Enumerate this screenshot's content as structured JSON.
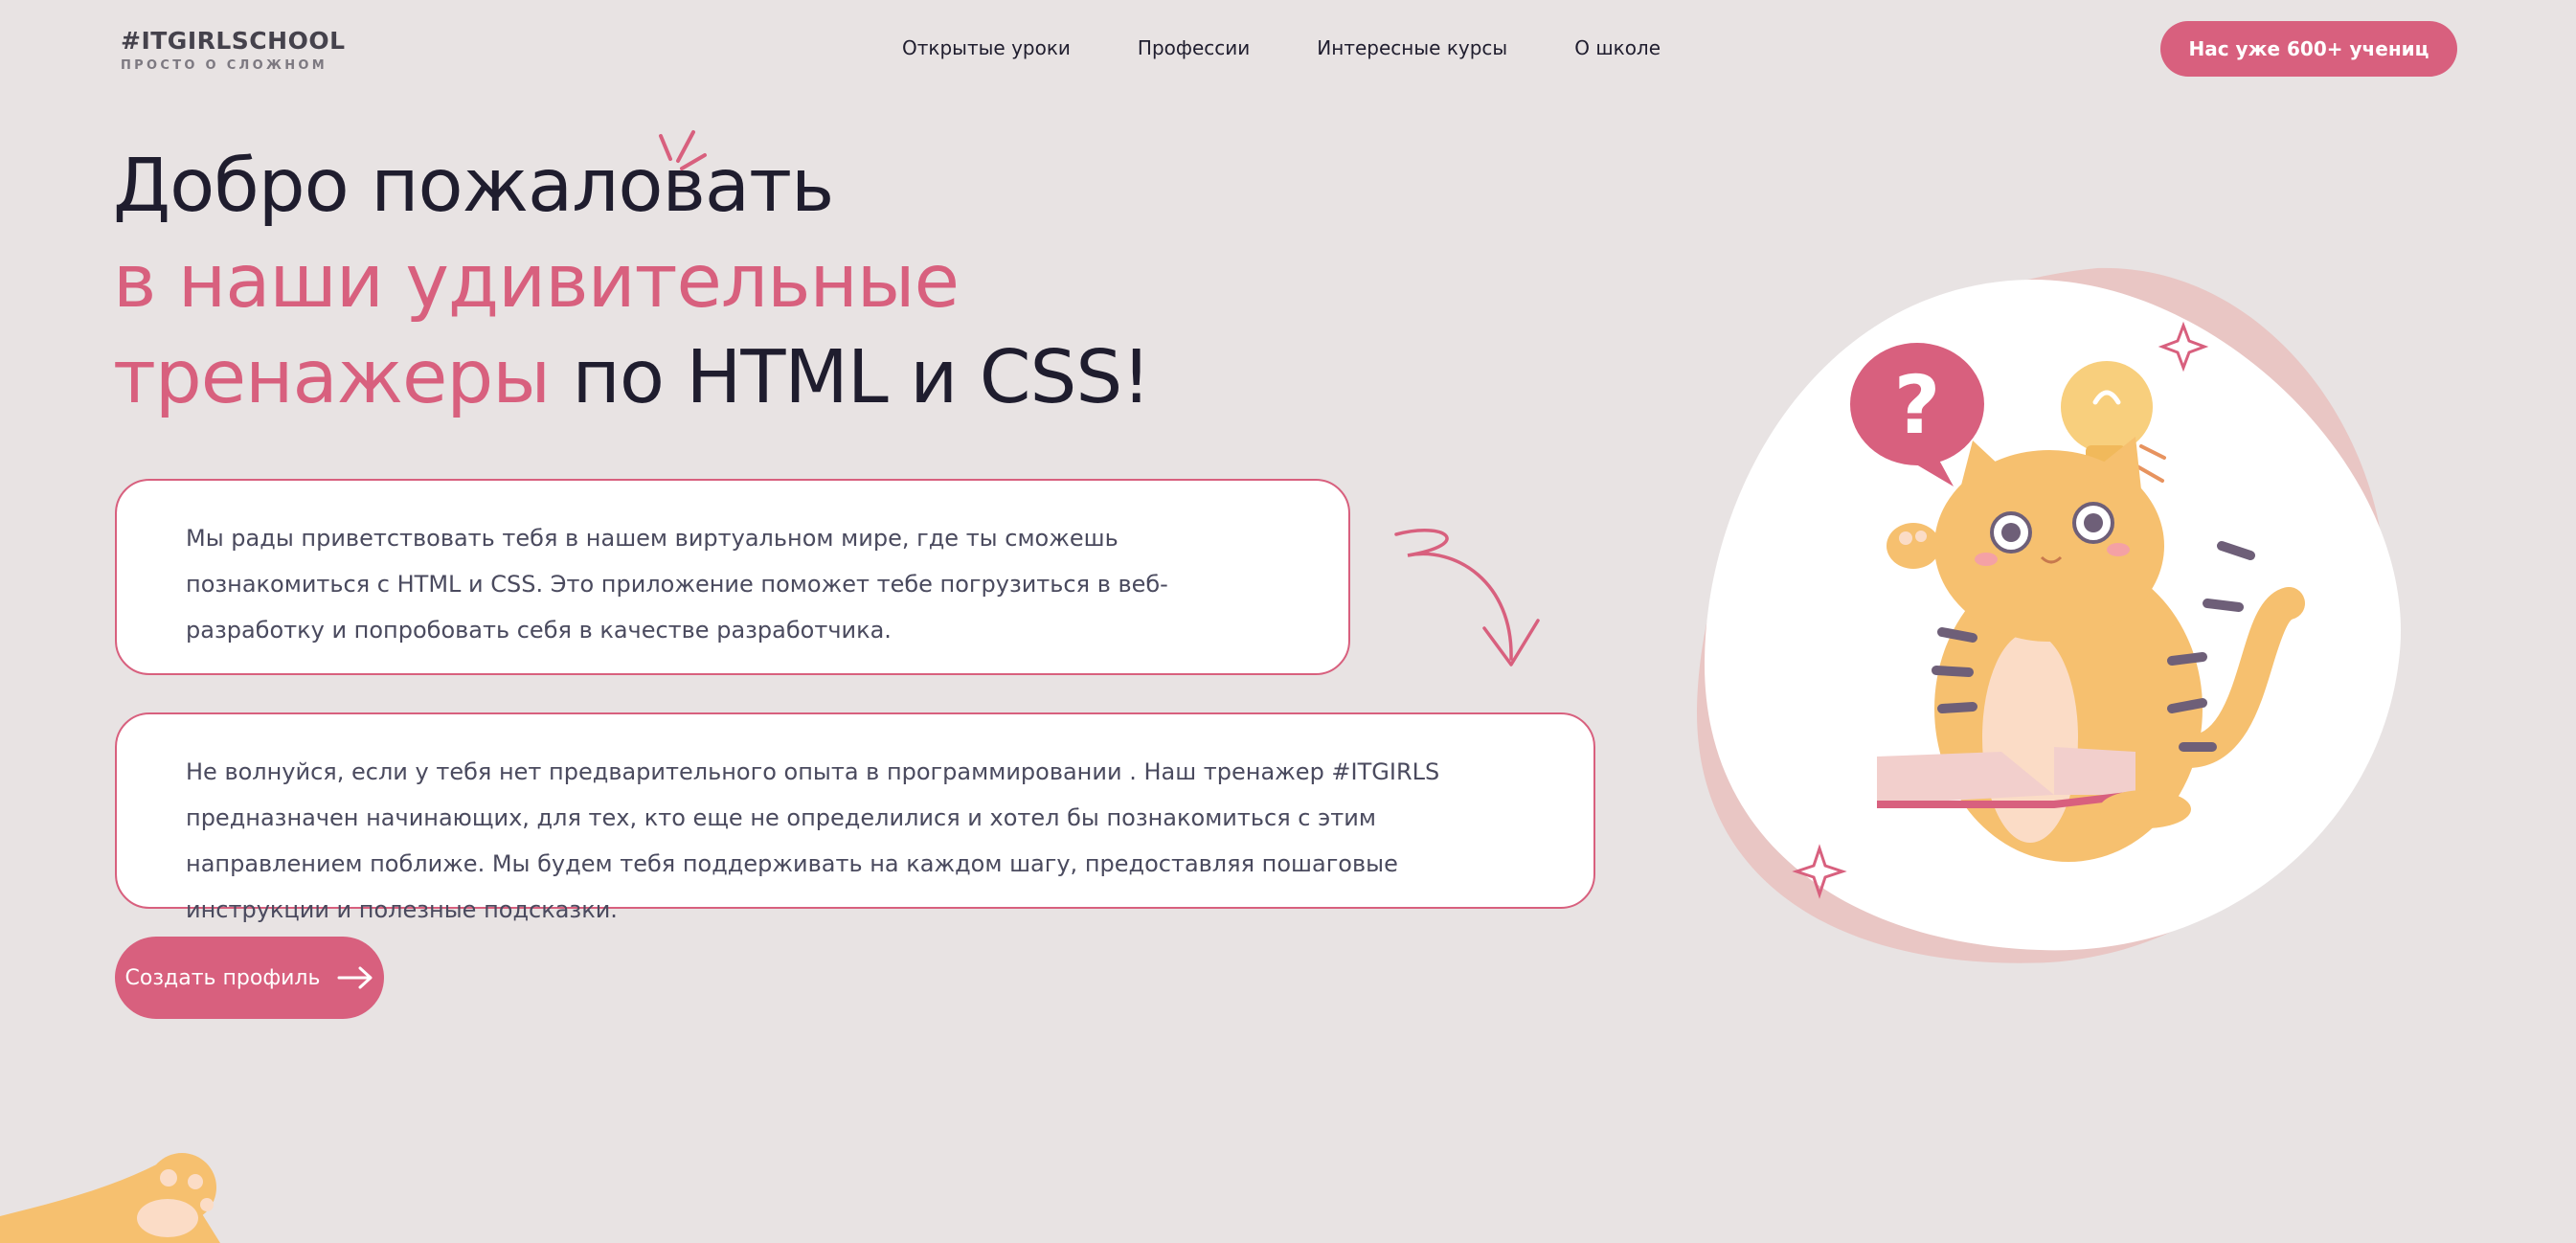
{
  "header": {
    "logo_main": "#ITGIRLSCHOOL",
    "logo_sub": "ПРОСТО О СЛОЖНОМ",
    "nav": [
      {
        "label": "Открытые уроки"
      },
      {
        "label": "Профессии"
      },
      {
        "label": "Интересные курсы"
      },
      {
        "label": "О школе"
      }
    ],
    "cta_label": "Нас уже 600+ учениц"
  },
  "hero": {
    "line1": "Добро пожаловать",
    "line2": "в наши удивительные",
    "line3_pink": "тренажеры",
    "line3_dark": " по HTML и CSS!"
  },
  "info": {
    "box1": "Мы рады приветствовать тебя в нашем виртуальном мире, где ты сможешь познакомиться с HTML и CSS. Это приложение поможет тебе погрузиться в веб-разработку и попробовать себя в качестве разработчика.",
    "box2": "Не волнуйся, если у тебя нет предварительного опыта в программировании . Наш тренажер #ITGIRLS предназначен начинающих, для тех, кто еще не определилися и хотел бы познакомиться с этим направлением поближе. Мы будем тебя поддерживать на каждом шагу, предоставляя пошаговые инструкции и полезные подсказки."
  },
  "actions": {
    "create_profile": "Создать профиль"
  },
  "illustration": {
    "bubble_text": "?"
  },
  "colors": {
    "accent": "#d8607e",
    "background": "#e8e3e3",
    "text_dark": "#1f1d2e",
    "cat": "#f6c06f",
    "blob": "#e9c6c4"
  },
  "icons": [
    "arrow-right-icon",
    "curly-arrow-icon",
    "question-bubble-icon",
    "lightbulb-icon",
    "sparkle-icon",
    "cat-illustration",
    "book-icon",
    "paw-icon"
  ]
}
